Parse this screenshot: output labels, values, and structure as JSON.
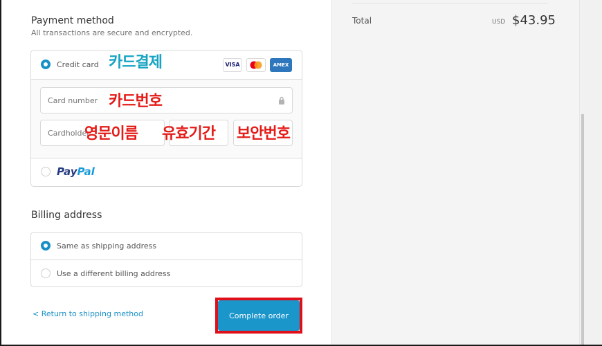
{
  "payment": {
    "title": "Payment method",
    "subtitle": "All transactions are secure and encrypted.",
    "credit_card_label": "Credit card",
    "card_logos": {
      "visa": "VISA",
      "amex": "AMEX"
    },
    "card_number_placeholder": "Card number",
    "cardholder_placeholder": "Cardholder",
    "paypal_label_pay": "Pay",
    "paypal_label_pal": "Pal"
  },
  "annotations": {
    "card_payment": "카드결제",
    "card_number": "카드번호",
    "english_name": "영문이름",
    "expiry": "유효기간",
    "security_code": "보안번호"
  },
  "billing": {
    "title": "Billing address",
    "options": [
      {
        "label": "Same as shipping address",
        "selected": true
      },
      {
        "label": "Use a different billing address",
        "selected": false
      }
    ]
  },
  "footer": {
    "back_label": "< Return to shipping method",
    "complete_label": "Complete order"
  },
  "summary": {
    "total_label": "Total",
    "currency": "USD",
    "total_amount": "$43.95"
  },
  "colors": {
    "accent": "#1990c6",
    "button": "#1b96cb",
    "highlight_outline": "#e0101a",
    "annotation_teal": "#16a3c2",
    "annotation_red": "#e41b17"
  }
}
